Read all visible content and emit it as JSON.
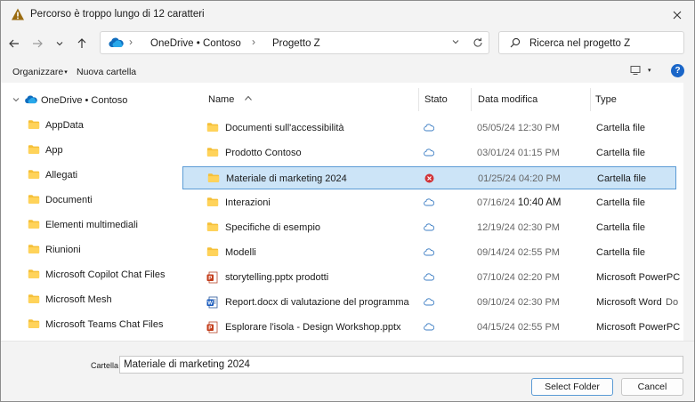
{
  "titlebar": {
    "title": "Percorso è troppo lungo di 12 caratteri"
  },
  "address": {
    "crumbs": [
      "OneDrive • Contoso",
      "Progetto Z"
    ]
  },
  "search": {
    "placeholder": "Ricerca nel progetto Z"
  },
  "commandbar": {
    "organize_label": "Organizzare",
    "new_folder_label": "Nuova cartella",
    "help_label": "?"
  },
  "tree": {
    "root_label": "OneDrive • Contoso",
    "items": [
      "AppData",
      "App",
      "Allegati",
      "Documenti",
      "Elementi multimediali",
      "Riunioni",
      "Microsoft Copilot Chat Files",
      "Microsoft Mesh",
      "Microsoft Teams Chat Files"
    ]
  },
  "columns": {
    "name": "Name",
    "status": "Stato",
    "date": "Data modifica",
    "type": "Type"
  },
  "files": [
    {
      "name": "Documenti sull'accessibilità",
      "date": "05/05/24 12:30 PM",
      "time": "",
      "type": "Cartella file",
      "extra": "",
      "kind": "folder",
      "status": "cloud"
    },
    {
      "name": "Prodotto Contoso",
      "date": "03/01/24 01:15 PM",
      "time": "",
      "type": "Cartella file",
      "extra": "",
      "kind": "folder",
      "status": "cloud"
    },
    {
      "name": "Materiale di marketing 2024",
      "date": "01/25/24 04:20 PM",
      "time": "",
      "type": "Cartella file",
      "extra": "",
      "kind": "folder",
      "status": "error"
    },
    {
      "name": "Interazioni",
      "date": "07/16/24 ",
      "time": "10:40 AM",
      "type": "Cartella file",
      "extra": "",
      "kind": "folder",
      "status": "cloud"
    },
    {
      "name": "Specifiche di esempio",
      "date": "12/19/24 02:30 PM",
      "time": "",
      "type": "Cartella file",
      "extra": "",
      "kind": "folder",
      "status": "cloud"
    },
    {
      "name": "Modelli",
      "date": "09/14/24 02:55 PM",
      "time": "",
      "type": "Cartella file",
      "extra": "",
      "kind": "folder",
      "status": "cloud"
    },
    {
      "name": "storytelling.pptx prodotti",
      "date": "07/10/24 02:20 PM",
      "time": "",
      "type": "Microsoft PowerPC",
      "extra": "",
      "kind": "pptx",
      "status": "cloud"
    },
    {
      "name": "Report.docx di valutazione del programma",
      "date": "09/10/24 02:30 PM",
      "time": "",
      "type": "Microsoft Word",
      "extra": "Do",
      "kind": "docx",
      "status": "cloud"
    },
    {
      "name": "Esplorare l'isola - Design Workshop.pptx",
      "date": "04/15/24 02:55 PM",
      "time": "",
      "type": "Microsoft PowerPC",
      "extra": "",
      "kind": "pptx",
      "status": "cloud"
    }
  ],
  "selected_index": 2,
  "filename": {
    "label": "Cartella",
    "value": "Materiale di marketing 2024"
  },
  "buttons": {
    "select_label": "Select Folder",
    "cancel_label": "Cancel"
  },
  "colors": {
    "accent": "#1a66c8",
    "selection_bg": "#cce4f7",
    "selection_border": "#5b9bd5",
    "folder": "#f5c038",
    "error": "#d13438",
    "warning": "#8a5a00"
  }
}
